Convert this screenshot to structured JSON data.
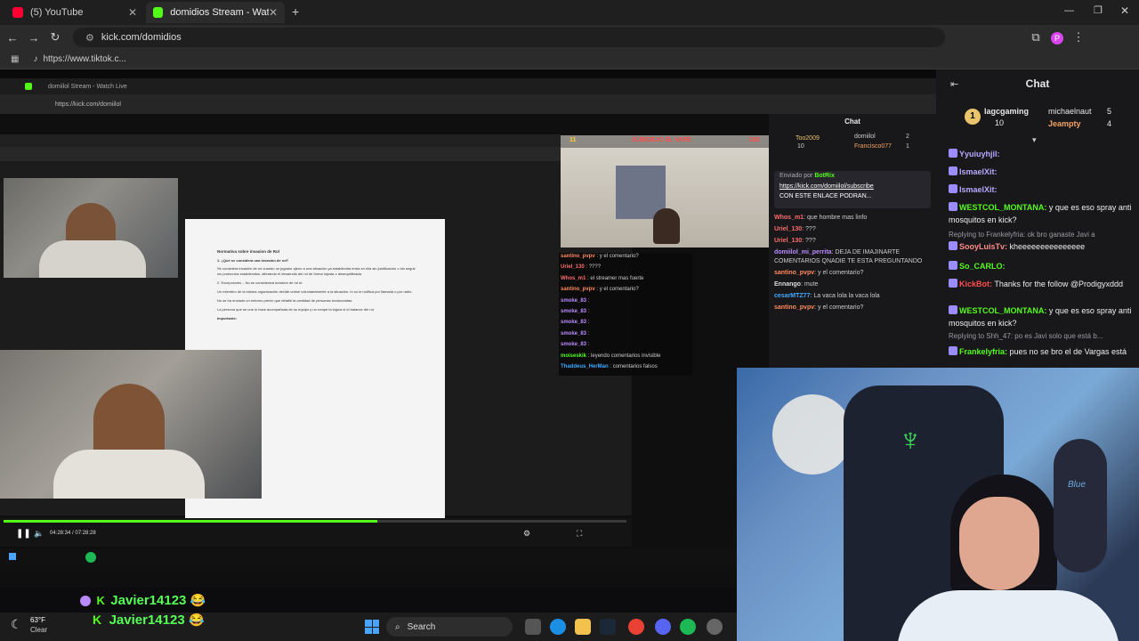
{
  "browser": {
    "tabs": [
      {
        "label": "(5) YouTube",
        "color": "#ff0033"
      },
      {
        "label": "domidios Stream - Watch Live o",
        "color": "#53fc18"
      }
    ],
    "url": "kick.com/domidios",
    "bookmark": "https://www.tiktok.c..."
  },
  "inner_browser": {
    "tab": "domiilol Stream - Watch Live",
    "url": "https://kick.com/domiilol",
    "chat_title": "Chat",
    "top_gifters": [
      {
        "name": "Too2009",
        "count": "10"
      },
      {
        "name": "domiilol",
        "count": "2"
      },
      {
        "name": "Francisco077",
        "count": "1"
      }
    ],
    "pinned_by": "Enviado por",
    "pinned_user": "BotRix",
    "pinned_link": "https://kick.com/domiilol/subscribe",
    "pinned_text": "CON ESTE ENLACE PODRAN...",
    "messages": [
      {
        "user": "Whos_m1",
        "text": "que hombre mas linfo",
        "color": "#ff6b6b"
      },
      {
        "user": "Uriel_130",
        "text": "???",
        "color": "#ff6b6b"
      },
      {
        "user": "Uriel_130",
        "text": "???",
        "color": "#ff6b6b"
      },
      {
        "user": "domiilol_mi_perrita",
        "text": "DEJA DE IMAJINARTE COMENTARIOS QNADIE TE ESTA PREGUNTANDO",
        "color": "#b98bff"
      },
      {
        "user": "santino_pvpv",
        "text": "y el comentario?",
        "color": "#ff8a5c"
      },
      {
        "user": "Ennango",
        "text": "mute",
        "color": "#dddddd"
      },
      {
        "user": "cesarMTZ77",
        "text": "La vaca lola la vaca lola",
        "color": "#3fa9ff"
      },
      {
        "user": "santino_pvpv",
        "text": "y el comentario?",
        "color": "#ff8a5c"
      }
    ]
  },
  "mini_overlay": {
    "title": "SUB/DEJO EL VAPE",
    "left_num": "11",
    "right_num": "200",
    "chat": [
      {
        "user": "santino_pvpv",
        "text": "y el comentario?",
        "color": "#ff8a5c"
      },
      {
        "user": "Uriel_130",
        "text": "????",
        "color": "#ff6b6b"
      },
      {
        "user": "Whos_m1",
        "text": "el streamer mas fuerte",
        "color": "#ff6b6b"
      },
      {
        "user": "santino_pvpv",
        "text": "y el comentario?",
        "color": "#ff8a5c"
      },
      {
        "user": "smoke_83",
        "text": "",
        "color": "#b98bff"
      },
      {
        "user": "smoke_83",
        "text": "",
        "color": "#b98bff"
      },
      {
        "user": "smoke_83",
        "text": "",
        "color": "#b98bff"
      },
      {
        "user": "smoke_83",
        "text": "",
        "color": "#b98bff"
      },
      {
        "user": "smoke_83",
        "text": "",
        "color": "#b98bff"
      },
      {
        "user": "moiseskik",
        "text": "leyendo comentarios invisible",
        "color": "#53fc18"
      },
      {
        "user": "Thaddeus_HerMan",
        "text": "comentarios falsos",
        "color": "#3fa9ff"
      }
    ]
  },
  "document": {
    "title": "Normativa sobre invasion de Rol",
    "heading1": "1. ¿Qué se considera una invasión de rol?",
    "para1": "Se considera invasión de rol cuando un jugador ajeno a una situación ya establecida entra en ella sin justificación o sin seguir los protocolos establecidos, alterando el desarrollo del rol de forma injusta o desequilibrada.",
    "heading2": "2. Excepciones – No se considerará invasión de rol si:",
    "para2": "Un miembro de la misma organización decide unirse voluntariamente a la situación. In so le notifica por llamada o por radio.",
    "para3": "No se ha enviado un entorno previo que detalle la cantidad de personas involucradas.",
    "para4": "La persona que se une lo hace acompañada de su equipo y no rompe la lógica ni el balance del rol.",
    "important": "Importante:"
  },
  "player": {
    "time": "04:28:34 / 07:28:28",
    "progress": 0.6
  },
  "chat": {
    "title": "Chat",
    "gifters": [
      {
        "name": "lagcgaming",
        "count": "10",
        "color": "#e9c46a"
      },
      {
        "name": "michaelnaut",
        "count": "5",
        "color": "#efeff1"
      },
      {
        "name": "Jeampty",
        "count": "4",
        "color": "#f4a261"
      }
    ],
    "messages": [
      {
        "kind": "msg",
        "user": "Yyuiuyhjil:",
        "text": "",
        "color": "#b6a9ff"
      },
      {
        "kind": "msg",
        "user": "IsmaelXit:",
        "text": "",
        "color": "#b6a9ff"
      },
      {
        "kind": "msg",
        "user": "IsmaelXit:",
        "text": "",
        "color": "#b6a9ff"
      },
      {
        "kind": "msg",
        "user": "WESTCOL_MONTANA:",
        "text": "y que es eso spray anti mosquitos en kick?",
        "color": "#53fc18"
      },
      {
        "kind": "reply",
        "text": "Replying to Frankelyfria: ok bro ganaste Javi a"
      },
      {
        "kind": "msg",
        "user": "SooyLuisTv:",
        "text": "kheeeeeeeeeeeeeee",
        "color": "#ff8a8a"
      },
      {
        "kind": "msg",
        "user": "So_CARLO:",
        "text": "",
        "color": "#53fc18"
      },
      {
        "kind": "msg",
        "user": "KickBot:",
        "text": "Thanks for the follow @Prodigyxddd",
        "color": "#ff4d4d"
      },
      {
        "kind": "msg",
        "user": "WESTCOL_MONTANA:",
        "text": "y que es eso spray anti mosquitos en kick?",
        "color": "#53fc18"
      },
      {
        "kind": "reply",
        "text": "Replying to Shh_47: po es Javi solo que está b..."
      },
      {
        "kind": "msg",
        "user": "Frankelyfria:",
        "text": "pues no se bro el de Vargas está",
        "color": "#53fc18"
      }
    ]
  },
  "overlay_names": [
    "Javier14123",
    "Javier14123"
  ],
  "taskbar": {
    "weather_temp": "63°F",
    "weather_desc": "Clear",
    "search": "Search"
  }
}
